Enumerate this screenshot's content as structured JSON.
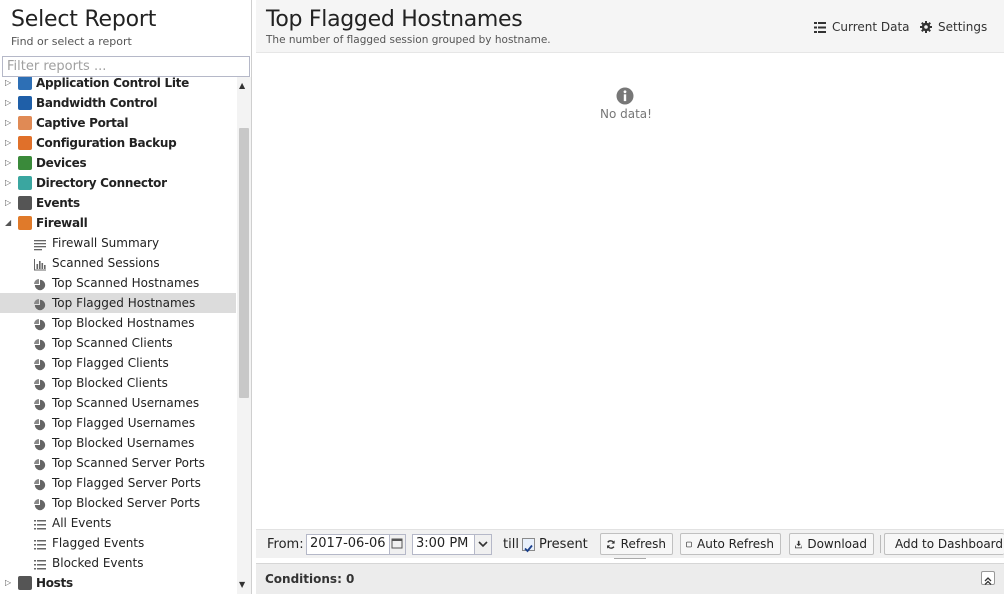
{
  "sidebar": {
    "title": "Select Report",
    "subtitle": "Find or select a report",
    "filter_placeholder": "Filter reports ...",
    "categories_before": [
      {
        "label": "Application Control Lite",
        "icon": "application-control-lite-icon",
        "color": "#2d6fb5"
      },
      {
        "label": "Bandwidth Control",
        "icon": "bandwidth-control-icon",
        "color": "#1f5fa8"
      },
      {
        "label": "Captive Portal",
        "icon": "captive-portal-icon",
        "color": "#e08a55"
      },
      {
        "label": "Configuration Backup",
        "icon": "configuration-backup-icon",
        "color": "#e0702a"
      },
      {
        "label": "Devices",
        "icon": "devices-icon",
        "color": "#3a8a3a"
      },
      {
        "label": "Directory Connector",
        "icon": "directory-connector-icon",
        "color": "#3aa6a0"
      },
      {
        "label": "Events",
        "icon": "events-icon",
        "color": "#555555"
      }
    ],
    "expanded_category": {
      "label": "Firewall",
      "icon": "firewall-icon",
      "color": "#e07a2a"
    },
    "reports": [
      {
        "label": "Firewall Summary",
        "icon": "text-lines-icon"
      },
      {
        "label": "Scanned Sessions",
        "icon": "bar-chart-icon"
      },
      {
        "label": "Top Scanned Hostnames",
        "icon": "pie-chart-icon"
      },
      {
        "label": "Top Flagged Hostnames",
        "icon": "pie-chart-icon",
        "selected": true
      },
      {
        "label": "Top Blocked Hostnames",
        "icon": "pie-chart-icon"
      },
      {
        "label": "Top Scanned Clients",
        "icon": "pie-chart-icon"
      },
      {
        "label": "Top Flagged Clients",
        "icon": "pie-chart-icon"
      },
      {
        "label": "Top Blocked Clients",
        "icon": "pie-chart-icon"
      },
      {
        "label": "Top Scanned Usernames",
        "icon": "pie-chart-icon"
      },
      {
        "label": "Top Flagged Usernames",
        "icon": "pie-chart-icon"
      },
      {
        "label": "Top Blocked Usernames",
        "icon": "pie-chart-icon"
      },
      {
        "label": "Top Scanned Server Ports",
        "icon": "pie-chart-icon"
      },
      {
        "label": "Top Flagged Server Ports",
        "icon": "pie-chart-icon"
      },
      {
        "label": "Top Blocked Server Ports",
        "icon": "pie-chart-icon"
      },
      {
        "label": "All Events",
        "icon": "list-icon"
      },
      {
        "label": "Flagged Events",
        "icon": "list-icon"
      },
      {
        "label": "Blocked Events",
        "icon": "list-icon"
      }
    ],
    "categories_after": [
      {
        "label": "Hosts",
        "icon": "hosts-icon",
        "color": "#555555"
      }
    ]
  },
  "report": {
    "title": "Top Flagged Hostnames",
    "description": "The number of flagged session grouped by hostname.",
    "current_data_label": "Current Data",
    "settings_label": "Settings",
    "no_data_text": "No data!"
  },
  "toolbar": {
    "from_label": "From:",
    "date_value": "2017-06-06",
    "time_value": "3:00 PM",
    "till_label": "till",
    "present_label": "Present",
    "present_checked": true,
    "refresh_label": "Refresh",
    "auto_refresh_label": "Auto Refresh",
    "download_label": "Download",
    "add_dashboard_label": "Add to Dashboard"
  },
  "conditions": {
    "label": "Conditions: 0"
  }
}
